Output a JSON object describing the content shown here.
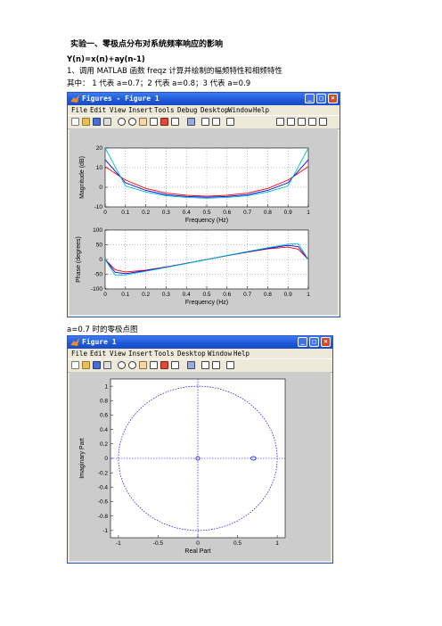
{
  "doc": {
    "heading": "实验一、零极点分布对系统频率响应的影响",
    "equation": "Y(n)=x(n)+ay(n-1)",
    "step1": "1、调用 MATLAB 函数 freqz 计算并绘制的幅频特性和相频特性",
    "legend_note": "其中： 1 代表 a=0.7；2 代表 a=0.8；3 代表 a=0.9",
    "caption2": "a=0.7 时的零极点图"
  },
  "figure1": {
    "title": "Figures - Figure 1",
    "menus": [
      "File",
      "Edit",
      "View",
      "Insert",
      "Tools",
      "Debug",
      "Desktop",
      "Window",
      "Help"
    ],
    "mag_ylabel": "Magnitude (dB)",
    "mag_xlabel": "Frequency (Hz)",
    "phase_ylabel": "Phase (degrees)",
    "phase_xlabel": "Frequency (Hz)"
  },
  "figure2": {
    "title": "Figure 1",
    "menus": [
      "File",
      "Edit",
      "View",
      "Insert",
      "Tools",
      "Desktop",
      "Window",
      "Help"
    ],
    "xlabel": "Real Part",
    "ylabel": "Imaginary Part"
  },
  "chart_data": [
    {
      "type": "line",
      "xlabel": "Frequency (Hz)",
      "ylabel": "Magnitude (dB)",
      "xlim": [
        0,
        1
      ],
      "ylim": [
        -10,
        20
      ],
      "xticks": [
        0,
        0.1,
        0.2,
        0.3,
        0.4,
        0.5,
        0.6,
        0.7,
        0.8,
        0.9,
        1
      ],
      "yticks": [
        -10,
        0,
        10,
        20
      ],
      "grid": true,
      "series": [
        {
          "color": "#ff0000",
          "a": 0.7,
          "x": [
            0,
            0.1,
            0.2,
            0.3,
            0.4,
            0.5,
            0.6,
            0.7,
            0.8,
            0.9,
            1
          ],
          "values": [
            10.5,
            3.7,
            -0.6,
            -3.0,
            -4.1,
            -4.6,
            -4.1,
            -3.0,
            -0.6,
            3.7,
            10.5
          ]
        },
        {
          "color": "#0000ff",
          "a": 0.8,
          "x": [
            0,
            0.1,
            0.2,
            0.3,
            0.4,
            0.5,
            0.6,
            0.7,
            0.8,
            0.9,
            1
          ],
          "values": [
            14.0,
            2.3,
            -1.6,
            -3.8,
            -4.7,
            -5.1,
            -4.7,
            -3.8,
            -1.6,
            2.3,
            14.0
          ]
        },
        {
          "color": "#00bfbf",
          "a": 0.9,
          "x": [
            0,
            0.1,
            0.2,
            0.3,
            0.4,
            0.5,
            0.6,
            0.7,
            0.8,
            0.9,
            1
          ],
          "values": [
            20.0,
            0.7,
            -2.4,
            -4.3,
            -5.2,
            -5.6,
            -5.2,
            -4.3,
            -2.4,
            0.7,
            20.0
          ]
        }
      ]
    },
    {
      "type": "line",
      "xlabel": "Frequency (Hz)",
      "ylabel": "Phase (degrees)",
      "xlim": [
        0,
        1
      ],
      "ylim": [
        -100,
        100
      ],
      "xticks": [
        0,
        0.1,
        0.2,
        0.3,
        0.4,
        0.5,
        0.6,
        0.7,
        0.8,
        0.9,
        1
      ],
      "yticks": [
        -100,
        -50,
        0,
        50,
        100
      ],
      "grid": true,
      "series": [
        {
          "color": "#ff0000",
          "a": 0.7,
          "x": [
            0,
            0.05,
            0.1,
            0.2,
            0.3,
            0.4,
            0.5,
            0.6,
            0.7,
            0.8,
            0.9,
            0.95,
            1
          ],
          "values": [
            0,
            -35,
            -42,
            -36,
            -25,
            -13,
            0,
            13,
            25,
            36,
            42,
            35,
            0
          ]
        },
        {
          "color": "#0000ff",
          "a": 0.8,
          "x": [
            0,
            0.05,
            0.1,
            0.2,
            0.3,
            0.4,
            0.5,
            0.6,
            0.7,
            0.8,
            0.9,
            0.95,
            1
          ],
          "values": [
            0,
            -44,
            -48,
            -38,
            -26,
            -13,
            0,
            13,
            26,
            38,
            48,
            44,
            0
          ]
        },
        {
          "color": "#00bfbf",
          "a": 0.9,
          "x": [
            0,
            0.05,
            0.1,
            0.2,
            0.3,
            0.4,
            0.5,
            0.6,
            0.7,
            0.8,
            0.9,
            0.95,
            1
          ],
          "values": [
            0,
            -54,
            -52,
            -40,
            -27,
            -14,
            0,
            14,
            27,
            40,
            52,
            54,
            0
          ]
        }
      ]
    },
    {
      "type": "scatter",
      "xlabel": "Real Part",
      "ylabel": "Imaginary Part",
      "xlim": [
        -1.1,
        1.1
      ],
      "ylim": [
        -1.1,
        1.1
      ],
      "xticks": [
        -1,
        -0.5,
        0,
        0.5,
        1
      ],
      "yticks": [
        -1,
        -0.8,
        -0.6,
        -0.4,
        -0.2,
        0,
        0.2,
        0.4,
        0.6,
        0.8,
        1
      ],
      "unit_circle": true,
      "zeros": [
        {
          "x": 0,
          "y": 0
        }
      ],
      "poles": [
        {
          "x": 0.7,
          "y": 0
        }
      ]
    }
  ],
  "colors": {
    "axes_bg": "#ffffff",
    "figure_bg": "#cccccc",
    "titlebar": "#1e56d8",
    "point_color": "#0000ff"
  }
}
